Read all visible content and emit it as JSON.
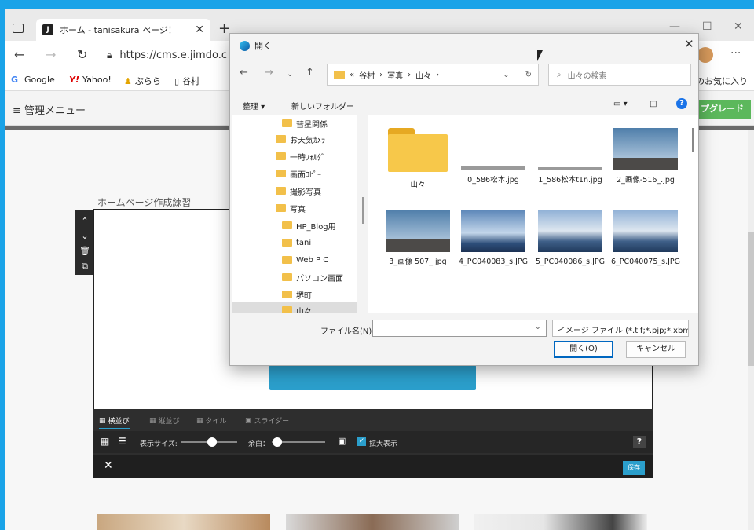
{
  "browser": {
    "tab_title": "ホーム - tanisakura ページ！",
    "tab_favicon": "J",
    "url": "https://cms.e.jimdo.c",
    "bookmarks": [
      {
        "label": "Google"
      },
      {
        "label": "Yahoo!"
      },
      {
        "label": "ぷらら"
      },
      {
        "label": "谷村"
      },
      {
        "label": "のお気に入り"
      }
    ]
  },
  "page": {
    "management_menu": "≡ 管理メニュー",
    "upgrade_label": "プグレード",
    "title": "ホームページ作成練習",
    "editor": {
      "tabs": [
        "横並び",
        "縦並び",
        "タイル",
        "スライダー"
      ],
      "display_size_label": "表示サイズ:",
      "margin_label": "余白：",
      "zoom_label": "拡大表示",
      "save_label": "保存",
      "help_label": "?",
      "close_label": "✕",
      "display_size_value": 0.55,
      "margin_value": 0.1
    }
  },
  "dialog": {
    "title": "開く",
    "path": [
      "«",
      "谷村",
      "›",
      "写真",
      "›",
      "山々",
      "›"
    ],
    "search_placeholder": "山々の検索",
    "organize_label": "整理 ▾",
    "new_folder_label": "新しいフォルダー",
    "tree": [
      {
        "label": "彗星関係"
      },
      {
        "label": "お天気ｶﾒﾗ"
      },
      {
        "label": "一時ﾌｫﾙﾀﾞ"
      },
      {
        "label": "画面ｺﾋﾟｰ"
      },
      {
        "label": "撮影写真"
      },
      {
        "label": "写真"
      },
      {
        "label": "HP_Blog用"
      },
      {
        "label": "tani"
      },
      {
        "label": "Web P C"
      },
      {
        "label": "パソコン画面"
      },
      {
        "label": "堺町"
      },
      {
        "label": "山々"
      }
    ],
    "files": [
      {
        "name": "山々",
        "kind": "folder"
      },
      {
        "name": "0_586松本.jpg",
        "kind": "flat"
      },
      {
        "name": "1_586松本t1n.jpg",
        "kind": "flat"
      },
      {
        "name": "2_画像-516_.jpg",
        "kind": "sky1"
      },
      {
        "name": "3_画像 507_.jpg",
        "kind": "sky1"
      },
      {
        "name": "4_PC040083_s.JPG",
        "kind": "sky2"
      },
      {
        "name": "5_PC040086_s.JPG",
        "kind": "sky3"
      },
      {
        "name": "6_PC040075_s.JPG",
        "kind": "sky3"
      }
    ],
    "filename_label": "ファイル名(N):",
    "filename_value": "",
    "filetype": "イメージ ファイル (*.tif;*.pjp;*.xbm;",
    "open_label": "開く(O)",
    "cancel_label": "キャンセル"
  }
}
